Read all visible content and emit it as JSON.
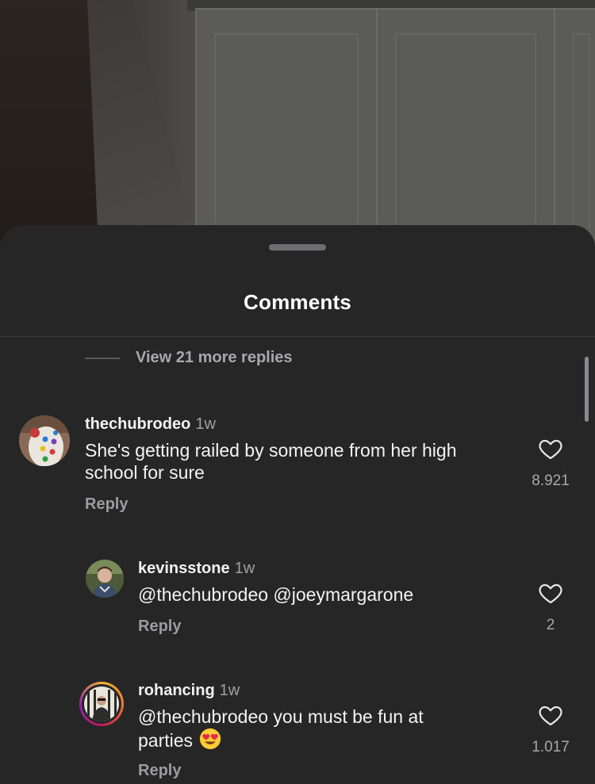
{
  "sheet": {
    "title": "Comments",
    "view_more_replies": "View 21 more replies"
  },
  "comments": [
    {
      "username": "thechubrodeo",
      "time": "1w",
      "text_line1": "She's getting railed by someone from her high",
      "text_line2": "school for sure",
      "reply_label": "Reply",
      "likes": "8.921",
      "avatar_icon": "avatar-colorful-dots"
    },
    {
      "username": "kevinsstone",
      "time": "1w",
      "text_line1": "@thechubrodeo @joeymargarone",
      "reply_label": "Reply",
      "likes": "2",
      "avatar_icon": "avatar-person-photo"
    },
    {
      "username": "rohancing",
      "time": "1w",
      "text_line1": "@thechubrodeo you must be fun at",
      "text_line2": "parties",
      "emoji": "heart-eyes-emoji",
      "reply_label": "Reply",
      "likes": "1.017",
      "avatar_icon": "avatar-story-ring"
    }
  ],
  "colors": {
    "sheet_bg": "#262627",
    "text_primary": "#f3f3f3",
    "text_secondary": "#a8a8aa",
    "story_ring_start": "#f9b233",
    "story_ring_end": "#c2185b"
  }
}
